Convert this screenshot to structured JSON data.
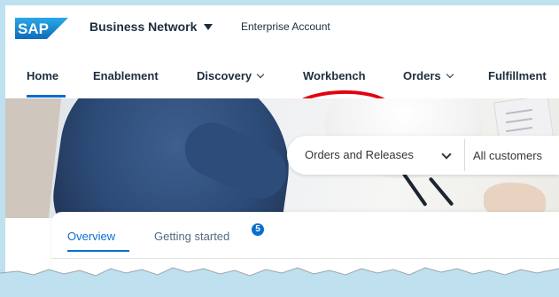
{
  "header": {
    "logo_text": "SAP",
    "brand": "Business Network",
    "account": "Enterprise Account"
  },
  "nav": {
    "items": [
      {
        "label": "Home",
        "active": true
      },
      {
        "label": "Enablement"
      },
      {
        "label": "Discovery",
        "has_menu": true
      },
      {
        "label": "Workbench",
        "highlighted": true
      },
      {
        "label": "Orders",
        "has_menu": true
      },
      {
        "label": "Fulfillment"
      }
    ]
  },
  "search": {
    "scope": "Orders and Releases",
    "placeholder": "All customers"
  },
  "tabs": {
    "overview": "Overview",
    "getting_started": "Getting started",
    "getting_started_badge": "5"
  },
  "colors": {
    "accent": "#0a6ed1",
    "highlight": "#e3000f",
    "logo_blue": "#1a8ad4"
  }
}
